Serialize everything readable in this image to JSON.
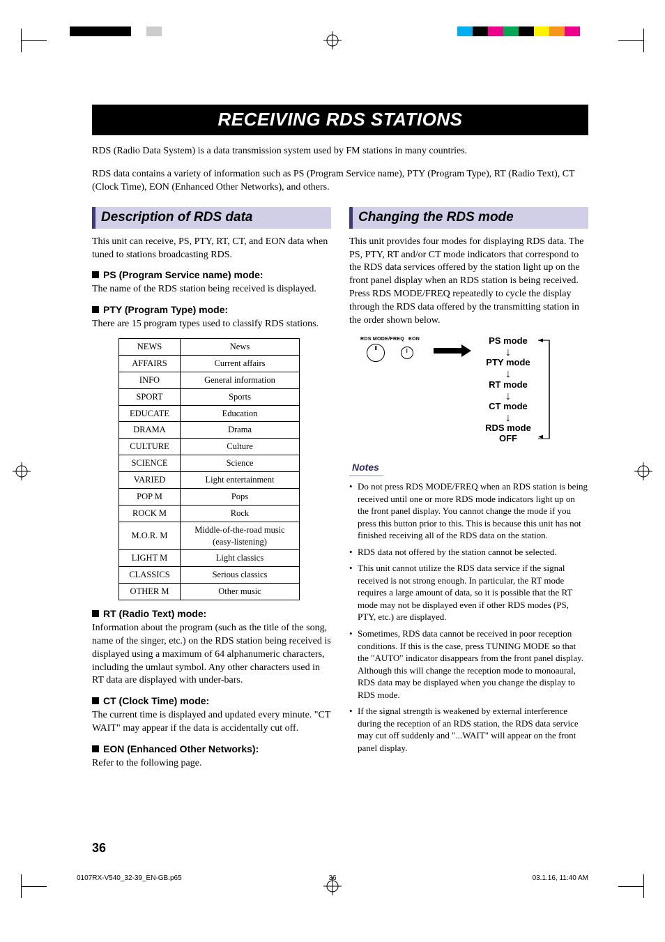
{
  "title": "RECEIVING RDS STATIONS",
  "intro_p1": "RDS (Radio Data System) is a data transmission system used by FM stations in many countries.",
  "intro_p2": "RDS data contains a variety of information such as PS (Program Service name), PTY (Program Type), RT (Radio Text), CT (Clock Time), EON (Enhanced Other Networks), and others.",
  "left": {
    "heading": "Description of RDS data",
    "intro": "This unit can receive, PS, PTY, RT, CT, and EON data when tuned to stations broadcasting RDS.",
    "ps_head": "PS (Program Service name) mode:",
    "ps_body": "The name of the RDS station being received is displayed.",
    "pty_head": "PTY (Program Type) mode:",
    "pty_body": "There are 15 program types used to classify RDS stations.",
    "rt_head": "RT (Radio Text) mode:",
    "rt_body": "Information about the program (such as the title of the song, name of the singer, etc.) on the RDS station being received is displayed using a maximum of 64 alphanumeric characters, including the umlaut symbol. Any other characters used in RT data are displayed with under-bars.",
    "ct_head": "CT (Clock Time) mode:",
    "ct_body": "The current time is displayed and updated every minute. \"CT WAIT\" may appear if the data is accidentally cut off.",
    "eon_head": "EON (Enhanced Other Networks):",
    "eon_body": "Refer to the following page.",
    "pty_table": [
      [
        "NEWS",
        "News"
      ],
      [
        "AFFAIRS",
        "Current affairs"
      ],
      [
        "INFO",
        "General information"
      ],
      [
        "SPORT",
        "Sports"
      ],
      [
        "EDUCATE",
        "Education"
      ],
      [
        "DRAMA",
        "Drama"
      ],
      [
        "CULTURE",
        "Culture"
      ],
      [
        "SCIENCE",
        "Science"
      ],
      [
        "VARIED",
        "Light entertainment"
      ],
      [
        "POP M",
        "Pops"
      ],
      [
        "ROCK M",
        "Rock"
      ],
      [
        "M.O.R. M",
        "Middle-of-the-road music (easy-listening)"
      ],
      [
        "LIGHT M",
        "Light classics"
      ],
      [
        "CLASSICS",
        "Serious classics"
      ],
      [
        "OTHER M",
        "Other music"
      ]
    ]
  },
  "right": {
    "heading": "Changing the RDS mode",
    "intro": "This unit provides four modes for displaying RDS data. The PS, PTY, RT and/or CT mode indicators that correspond to the RDS data services offered by the station light up on the front panel display when an RDS station is being received. Press RDS MODE/FREQ repeatedly to cycle the display through the RDS data offered by the transmitting station in the order shown below.",
    "knob_label_left": "RDS MODE/FREQ",
    "knob_label_right": "EON",
    "modes": [
      "PS mode",
      "PTY mode",
      "RT mode",
      "CT mode",
      "RDS mode OFF"
    ],
    "notes_head": "Notes",
    "notes": [
      "Do not press RDS MODE/FREQ when an RDS station is being received until one or more RDS mode indicators light up on the front panel display. You cannot change the mode if you press this button prior to this. This is because this unit has not finished receiving all of the RDS data on the station.",
      "RDS data not offered by the station cannot be selected.",
      "This unit cannot utilize the RDS data service if the signal received is not strong enough. In particular, the RT mode requires a large amount of data, so it is possible that the RT mode may not be displayed even if other RDS modes (PS, PTY, etc.) are displayed.",
      "Sometimes, RDS data cannot be received in poor reception conditions. If this is the case, press TUNING MODE so that the \"AUTO\" indicator disappears from the front panel display. Although this will change the reception mode to monoaural, RDS data may be displayed when you change the display to RDS mode.",
      "If the signal strength is weakened by external interference during the reception of an RDS station, the RDS data service may cut off suddenly and \"...WAIT\" will appear on the front panel display."
    ]
  },
  "page_number": "36",
  "footer": {
    "file": "0107RX-V540_32-39_EN-GB.p65",
    "page": "36",
    "timestamp": "03.1.16, 11:40 AM"
  },
  "colors": {
    "top_left_bar": [
      "#000",
      "#000",
      "#000",
      "#000",
      "#fff",
      "#ccc",
      "#fff"
    ],
    "top_right_bar": [
      "#00aeef",
      "#000",
      "#ec008c",
      "#00a651",
      "#000",
      "#fff200",
      "#f7941d",
      "#ec008c",
      "#fff"
    ]
  }
}
